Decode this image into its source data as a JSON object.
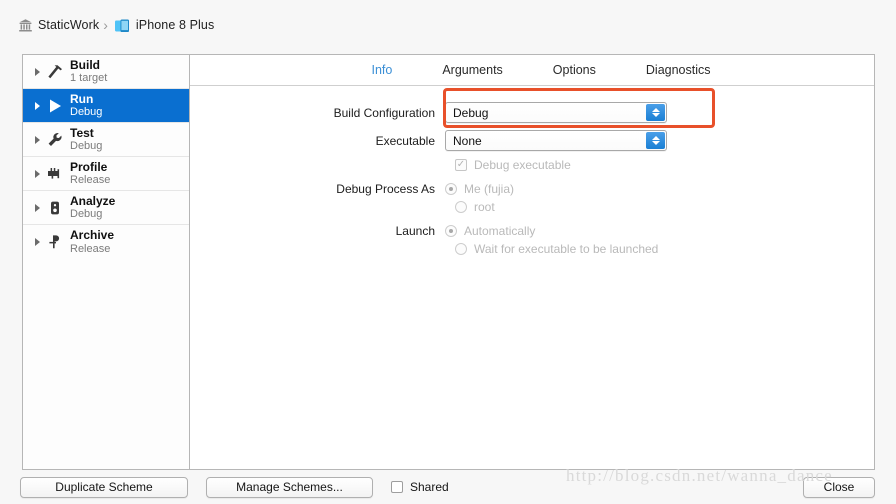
{
  "titlebar": {
    "project": {
      "label": "StaticWork",
      "icon": "xcode-project-icon"
    },
    "separator": "›",
    "destination": {
      "label": "iPhone 8 Plus",
      "icon": "iphone-device-icon"
    }
  },
  "sidebar": {
    "items": [
      {
        "name": "Build",
        "sub": "1 target",
        "icon": "hammer-icon",
        "selected": false
      },
      {
        "name": "Run",
        "sub": "Debug",
        "icon": "play-icon",
        "selected": true
      },
      {
        "name": "Test",
        "sub": "Debug",
        "icon": "wrench-icon",
        "selected": false
      },
      {
        "name": "Profile",
        "sub": "Release",
        "icon": "gauge-icon",
        "selected": false
      },
      {
        "name": "Analyze",
        "sub": "Debug",
        "icon": "analyze-icon",
        "selected": false
      },
      {
        "name": "Archive",
        "sub": "Release",
        "icon": "archive-icon",
        "selected": false
      }
    ]
  },
  "tabs": [
    {
      "label": "Info",
      "active": true
    },
    {
      "label": "Arguments",
      "active": false
    },
    {
      "label": "Options",
      "active": false
    },
    {
      "label": "Diagnostics",
      "active": false
    }
  ],
  "form": {
    "build_configuration": {
      "label": "Build Configuration",
      "value": "Debug"
    },
    "executable": {
      "label": "Executable",
      "value": "None"
    },
    "debug_executable": {
      "label": "Debug executable",
      "checked": true,
      "check_glyph": "✓"
    },
    "debug_process_as": {
      "label": "Debug Process As",
      "options": [
        {
          "label": "Me (fujia)",
          "selected": true
        },
        {
          "label": "root",
          "selected": false
        }
      ]
    },
    "launch": {
      "label": "Launch",
      "options": [
        {
          "label": "Automatically",
          "selected": true
        },
        {
          "label": "Wait for executable to be launched",
          "selected": false
        }
      ]
    }
  },
  "annotation": {
    "color": "#e8502a",
    "shape": "rectangle-highlight"
  },
  "bottombar": {
    "duplicate_scheme": "Duplicate Scheme",
    "manage_schemes": "Manage Schemes...",
    "shared": {
      "label": "Shared",
      "checked": false
    },
    "close": "Close"
  },
  "watermark": "http://blog.csdn.net/wanna_dance",
  "colors": {
    "selection_blue": "#0a6fd0",
    "active_tab": "#3b8fd6",
    "stepper_blue": "#1a7fd4",
    "annotation_red": "#e8502a"
  }
}
